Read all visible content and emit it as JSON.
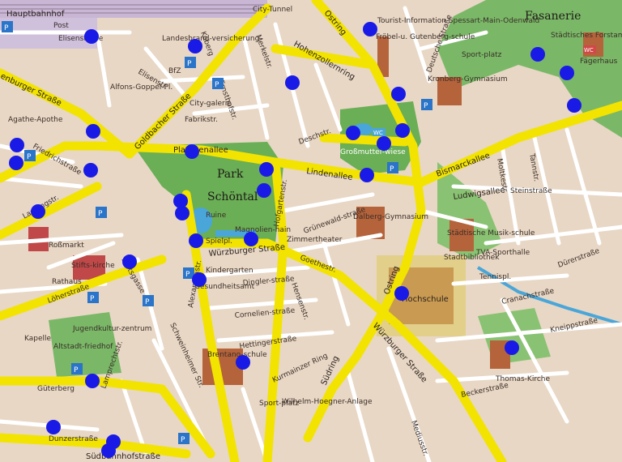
{
  "map": {
    "district_labels": {
      "fasanerie": "Fasanerie",
      "park": "Park",
      "schoental": "Schöntal"
    },
    "street_labels": {
      "goldbacher": "Goldbacher Straße",
      "platanenallee": "Platanenallee",
      "lindenallee": "Lindenallee",
      "bismarckallee": "Bismarckallee",
      "ludwigsallee": "Ludwigsallee",
      "wuerzburger_upper": "Würzburger Straße",
      "wuerzburger_lower": "Würzburger Straße",
      "hohenzollernring": "Hohenzollernring",
      "ostring_top": "Ostring",
      "ostring_mid": "Ostring",
      "suedring": "Südring",
      "weissenburger": "enburger Straße",
      "friedrichstrasse": "Friedrichstraße",
      "elisenstrasse_top": "Elisenstraße",
      "elisenstrasse": "Elisenstr.",
      "fabrikstr": "Fabrikstr.",
      "deschstr": "Deschstr.",
      "alexandrastr": "Alexandrastr.",
      "schweinheimer": "Schweinheimer Str.",
      "hofgartenstr": "Hofgartenstr.",
      "suedbahnhofstr": "Südbahnhofstraße",
      "loehrerstr": "Löherstraße",
      "landingstr": "Landingstr.",
      "kurmainzer_ring": "Kurmainzer Ring",
      "hettingerstr": "Hettingerstraße",
      "goethestr": "Goethestr.",
      "dinglerstr": "Dingler-straße",
      "corneliusstr": "Cornelien-straße",
      "grunewaldstr": "Grünewald-straße",
      "steinstr": "Steinstraße",
      "tannstr": "Tannstr.",
      "cranachstr": "Cranachstraße",
      "knippstr": "Kneippstraße",
      "beckerstr": "Beckerstraße",
      "duererstr": "Dürerstraße",
      "moltkestr": "Moltkestr.",
      "deutschestr": "Deutsche Straße",
      "lamprechtstr": "Lamprechtstr.",
      "gueterberg": "Güterberg",
      "dunzerstr": "Dunzerstraße",
      "citytunnel": "City-Tunnel",
      "kobergstr": "Koberg",
      "merkelstr": "Merkelstr.",
      "ernsthofstr": "Ernsthofstr.",
      "weissenburg": "Weißenburger",
      "mediusstr": "Mediusstr.",
      "lindenstr": "Lindenstr.",
      "hensenstr": "Hensenstr.",
      "rossmarkt": "Roßmarkt",
      "stiftsgasse": "Stiftsgasse"
    },
    "poi_labels": {
      "hauptbahnhof": "Hauptbahnhof",
      "post": "Post",
      "city_galerie": "City-galerie",
      "tourist_info": "Tourist-Information Spessart-Main-Odenwald",
      "sportplatz_top": "Sport-platz",
      "kronberg_gym": "Kronberg-Gymnasium",
      "staedt_forstamt": "Städtisches Forstamt",
      "faegerhaus": "Fägerhaus",
      "grossmutter": "Großmutter-wiese",
      "ruine": "Ruine",
      "spielpl": "Spielpl.",
      "magnolien": "Magnolien-hain",
      "hochschule": "Hochschule",
      "stadtbibliothek": "Stadtbibliothek",
      "tennispl": "Tennispl.",
      "stiftskirche": "Stifts-kirche",
      "rathaus": "Rathaus",
      "altstadtfriedhof": "Altstadt-friedhof",
      "jugendkulturzentrum": "Jugendkultur-zentrum",
      "dalberg_gym": "Dalberg-Gymnasium",
      "kindergarten": "Kindergarten",
      "zimmertheater": "Zimmertheater",
      "thomas_kirche": "Thomas-Kirche",
      "kapelle": "Kapelle",
      "wilhelm_hoegner": "Wilhelm-Hoegner-Anlage",
      "sportplatz_bottom": "Sport-platz",
      "tva_sporthalle": "TVA-Sporthalle",
      "gesundheitsamt": "Gesundheitsamt",
      "landesbrand": "Landesbrand-versicherung",
      "bfz": "BfZ",
      "froebel": "Fröbel-u. Gutenberg-schule",
      "brentano": "Brentano-schule",
      "alfonsgoppel": "Alfons-Goppel-Pl.",
      "alte_schule": "Agathe-Apothe",
      "musikschule": "Städtische Musik-schule"
    },
    "markers": [
      {
        "id": "m1",
        "color": "#1a1ae6"
      },
      {
        "id": "m2",
        "color": "#1a1ae6"
      },
      {
        "id": "m3",
        "color": "#1a1ae6"
      },
      {
        "id": "m4",
        "color": "#1a1ae6"
      },
      {
        "id": "m5",
        "color": "#1a1ae6"
      },
      {
        "id": "m6",
        "color": "#1a1ae6"
      },
      {
        "id": "m7",
        "color": "#1a1ae6"
      },
      {
        "id": "m8",
        "color": "#1a1ae6"
      },
      {
        "id": "m9",
        "color": "#1a1ae6"
      },
      {
        "id": "m10",
        "color": "#1a1ae6"
      },
      {
        "id": "m11",
        "color": "#1a1ae6"
      },
      {
        "id": "m12",
        "color": "#1a1ae6"
      },
      {
        "id": "m13",
        "color": "#1a1ae6"
      },
      {
        "id": "m14",
        "color": "#1a1ae6"
      },
      {
        "id": "m15",
        "color": "#1a1ae6"
      },
      {
        "id": "m16",
        "color": "#1a1ae6"
      },
      {
        "id": "m17",
        "color": "#1a1ae6"
      },
      {
        "id": "m18",
        "color": "#1a1ae6"
      },
      {
        "id": "m19",
        "color": "#1a1ae6"
      },
      {
        "id": "m20",
        "color": "#1a1ae6"
      },
      {
        "id": "m21",
        "color": "#1a1ae6"
      },
      {
        "id": "m22",
        "color": "#1a1ae6"
      },
      {
        "id": "m23",
        "color": "#1a1ae6"
      },
      {
        "id": "m24",
        "color": "#1a1ae6"
      },
      {
        "id": "m25",
        "color": "#1a1ae6"
      },
      {
        "id": "m26",
        "color": "#1a1ae6"
      },
      {
        "id": "m27",
        "color": "#1a1ae6"
      },
      {
        "id": "m28",
        "color": "#1a1ae6"
      },
      {
        "id": "m29",
        "color": "#1a1ae6"
      },
      {
        "id": "m30",
        "color": "#1a1ae6"
      },
      {
        "id": "m31",
        "color": "#1a1ae6"
      },
      {
        "id": "m32",
        "color": "#1a1ae6"
      },
      {
        "id": "m33",
        "color": "#1a1ae6"
      }
    ],
    "parking_symbol": "P",
    "wc_symbol": "WC",
    "colors": {
      "background": "#e8d7c5",
      "main_road": "#f2e300",
      "minor_road": "#ffffff",
      "park": "#6aae56",
      "building": "#b5633b",
      "water": "#4aa6d8",
      "marker": "#1a1ae6",
      "parking": "#2a74c9"
    }
  }
}
